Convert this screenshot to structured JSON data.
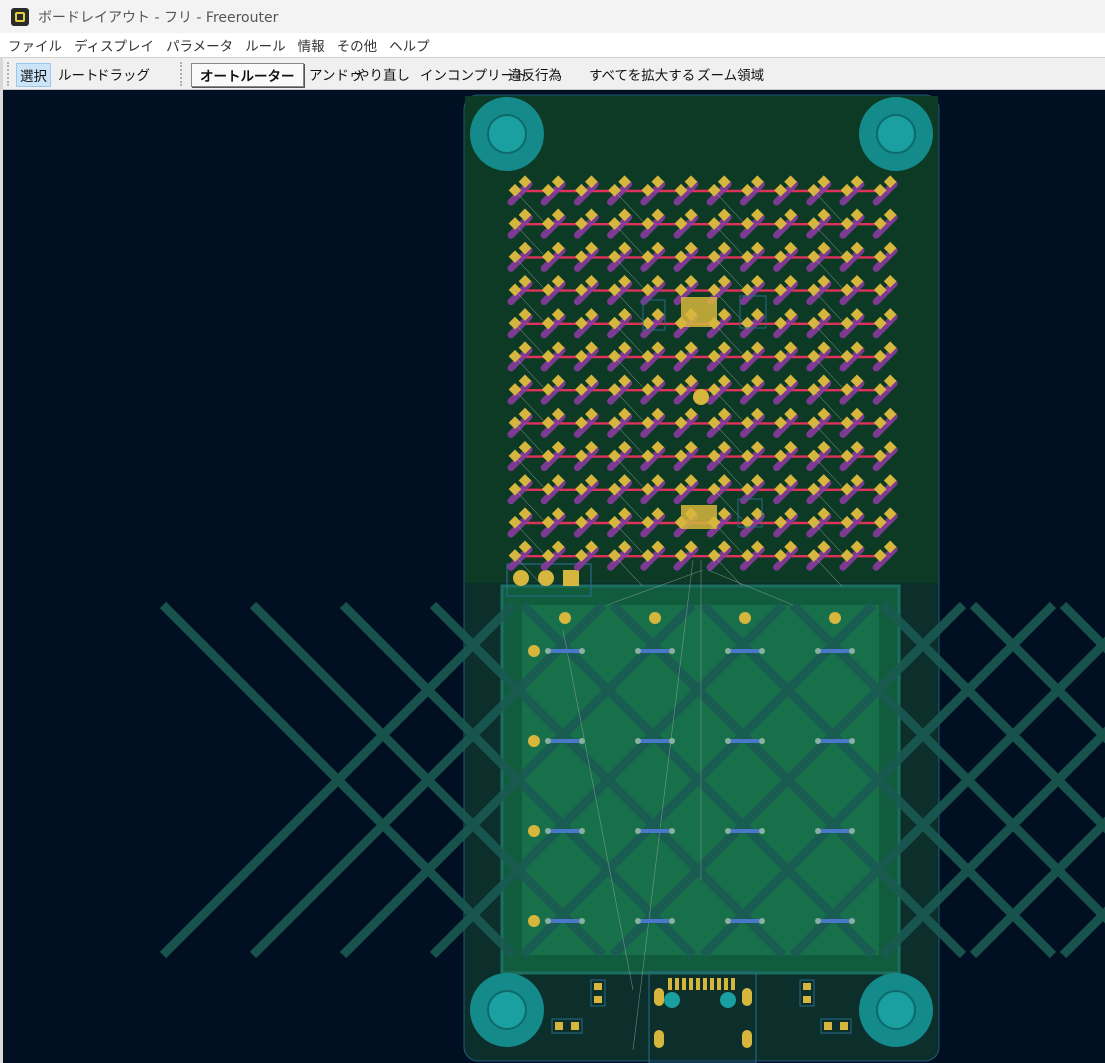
{
  "window": {
    "title": "ボードレイアウト - フリ - Freerouter",
    "icon": "freerouter-app-icon"
  },
  "menu": [
    "ファイル",
    "ディスプレイ",
    "パラメータ",
    "ルール",
    "情報",
    "その他",
    "ヘルプ"
  ],
  "toolbar": {
    "select": "選択",
    "route": "ルート",
    "drag": "ドラッグ",
    "autorouter": "オートルーター",
    "undo": "アンドゥ",
    "redo": "やり直し",
    "incomplete": "インコンプリート",
    "violations": "違反行為",
    "zoom_all": "すべてを拡大する",
    "zoom_region": "ズーム領域"
  },
  "colors": {
    "canvas_bg": "#001022",
    "board_top": "#0c3a24",
    "board_bottom": "#0c2f2b",
    "pad": "#d6b63c",
    "trace_red": "#e0305c",
    "trace_blue": "#4a78c8",
    "mounting_hole": "#1aa0a0",
    "keypad_fill": "#18704a"
  }
}
